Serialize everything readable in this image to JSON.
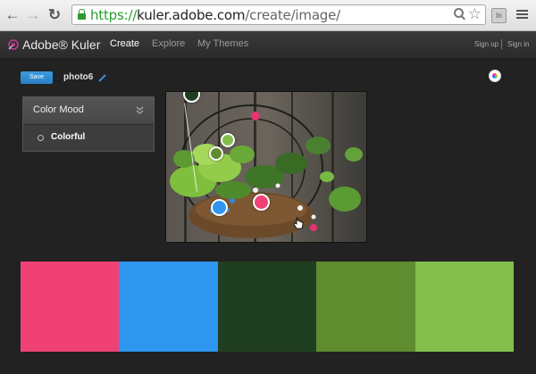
{
  "browser": {
    "url_scheme": "https://",
    "url_host": "kuler.adobe.com",
    "url_path": "/create/image/",
    "extension_label": "In"
  },
  "app": {
    "brand": "Adobe® Kuler",
    "nav": [
      {
        "label": "Create",
        "active": true
      },
      {
        "label": "Explore",
        "active": false
      },
      {
        "label": "My Themes",
        "active": false
      }
    ],
    "sign_up": "Sign up",
    "sign_in": "Sign in"
  },
  "toolbar": {
    "save_label": "Save",
    "filename": "photo6"
  },
  "mood": {
    "title": "Color Mood",
    "selected": "Colorful"
  },
  "colors": {
    "accent": "#2a86d1",
    "swatches": [
      "#f04175",
      "#2e96ef",
      "#203f20",
      "#5e8c2f",
      "#84bf4e"
    ]
  }
}
